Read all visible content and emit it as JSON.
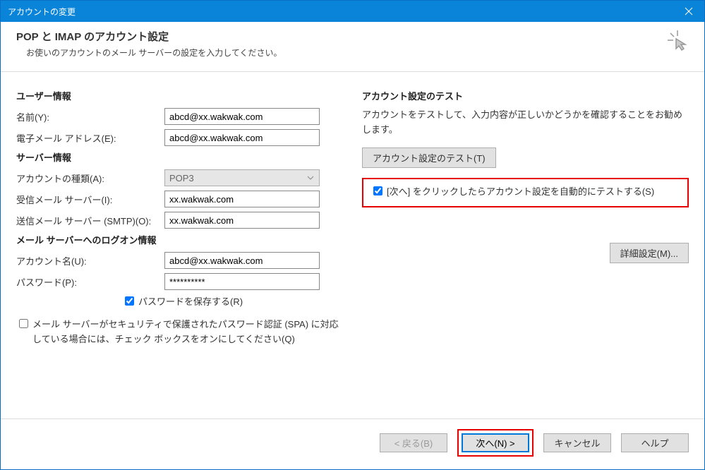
{
  "titlebar": {
    "title": "アカウントの変更"
  },
  "header": {
    "title": "POP と IMAP のアカウント設定",
    "subtitle": "お使いのアカウントのメール サーバーの設定を入力してください。"
  },
  "sections": {
    "user_info": "ユーザー情報",
    "server_info": "サーバー情報",
    "logon_info": "メール サーバーへのログオン情報",
    "test_title": "アカウント設定のテスト"
  },
  "labels": {
    "name": "名前(Y):",
    "email": "電子メール アドレス(E):",
    "account_type": "アカウントの種類(A):",
    "incoming": "受信メール サーバー(I):",
    "outgoing": "送信メール サーバー (SMTP)(O):",
    "account_name": "アカウント名(U):",
    "password": "パスワード(P):",
    "save_password": "パスワードを保存する(R)",
    "spa": "メール サーバーがセキュリティで保護されたパスワード認証 (SPA) に対応している場合には、チェック ボックスをオンにしてください(Q)",
    "test_desc": "アカウントをテストして、入力内容が正しいかどうかを確認することをお勧めします。",
    "auto_test": "[次へ] をクリックしたらアカウント設定を自動的にテストする(S)"
  },
  "values": {
    "name": "abcd@xx.wakwak.com",
    "email": "abcd@xx.wakwak.com",
    "account_type": "POP3",
    "incoming": "xx.wakwak.com",
    "outgoing": "xx.wakwak.com",
    "account_name": "abcd@xx.wakwak.com",
    "password": "**********"
  },
  "buttons": {
    "test": "アカウント設定のテスト(T)",
    "details": "詳細設定(M)...",
    "back": "< 戻る(B)",
    "next": "次へ(N) >",
    "cancel": "キャンセル",
    "help": "ヘルプ"
  },
  "checkboxes": {
    "save_password": true,
    "spa": false,
    "auto_test": true
  }
}
